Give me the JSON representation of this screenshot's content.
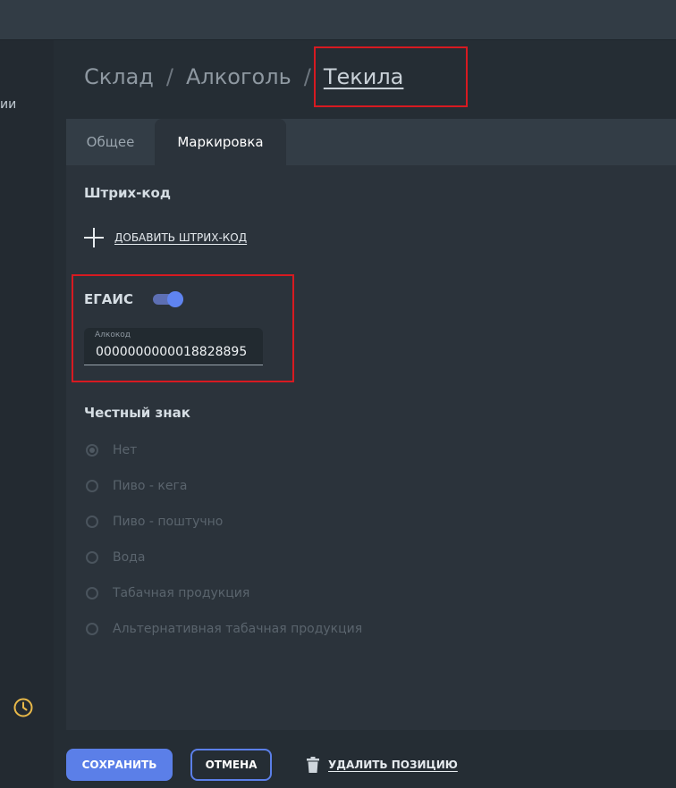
{
  "sidebar": {
    "partial_label": "ии",
    "history_icon": "clock-icon",
    "accent_color": "#e9b949"
  },
  "breadcrumb": {
    "items": [
      "Склад",
      "Алкоголь"
    ],
    "separator": "/",
    "current": "Текила"
  },
  "tabs": [
    {
      "label": "Общее",
      "active": false
    },
    {
      "label": "Маркировка",
      "active": true
    }
  ],
  "barcode": {
    "title": "Штрих-код",
    "add_label": "ДОБАВИТЬ ШТРИХ-КОД",
    "add_icon": "plus-icon"
  },
  "egais": {
    "title": "ЕГАИС",
    "enabled": true,
    "alcocode": {
      "label": "Алкокод",
      "value": "0000000000018828895"
    }
  },
  "honest_sign": {
    "title": "Честный знак",
    "options": [
      "Нет",
      "Пиво - кега",
      "Пиво - поштучно",
      "Вода",
      "Табачная продукция",
      "Альтернативная табачная продукция"
    ],
    "selected": "Нет"
  },
  "actions": {
    "save_label": "СОХРАНИТЬ",
    "cancel_label": "ОТМЕНА",
    "delete_label": "УДАЛИТЬ ПОЗИЦИЮ",
    "delete_icon": "trash-icon"
  },
  "colors": {
    "accent": "#5b7fe8",
    "highlight": "#d71a21"
  }
}
